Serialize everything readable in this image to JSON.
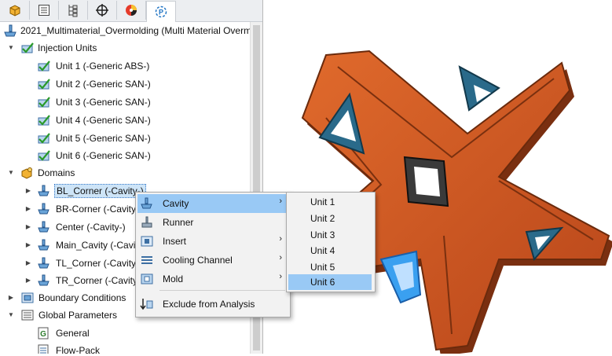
{
  "tabs": [
    {
      "name": "feature-manager",
      "icon": "part-icon"
    },
    {
      "name": "property-manager",
      "icon": "list-icon"
    },
    {
      "name": "configuration-manager",
      "icon": "config-icon"
    },
    {
      "name": "dimxpert-manager",
      "icon": "crosshair-icon"
    },
    {
      "name": "display-manager",
      "icon": "appearance-icon"
    },
    {
      "name": "plastics-manager",
      "icon": "plastics-icon",
      "active": true
    }
  ],
  "tree": {
    "root": "2021_Multimaterial_Overmolding (Multi Material Overmolc",
    "injection_units": {
      "label": "Injection Units",
      "units": [
        "Unit 1 (-Generic ABS-)",
        "Unit 2 (-Generic SAN-)",
        "Unit 3 (-Generic SAN-)",
        "Unit 4 (-Generic SAN-)",
        "Unit 5 (-Generic SAN-)",
        "Unit 6 (-Generic SAN-)"
      ]
    },
    "domains": {
      "label": "Domains",
      "items": [
        "BL_Corner (-Cavity-)",
        "BR-Corner (-Cavity-)",
        "Center (-Cavity-)",
        "Main_Cavity (-Cavity-)",
        "TL_Corner (-Cavity-)",
        "TR_Corner (-Cavity-)"
      ]
    },
    "boundary_conditions": "Boundary Conditions",
    "global_parameters": {
      "label": "Global Parameters",
      "items": [
        "General",
        "Flow-Pack"
      ]
    }
  },
  "context_menu": {
    "items": [
      {
        "label": "Cavity",
        "submenu": true,
        "highlighted": true,
        "icon": "cavity-icon"
      },
      {
        "label": "Runner",
        "submenu": false,
        "icon": "runner-icon"
      },
      {
        "label": "Insert",
        "submenu": true,
        "icon": "insert-icon"
      },
      {
        "label": "Cooling Channel",
        "submenu": true,
        "icon": "cooling-channel-icon"
      },
      {
        "label": "Mold",
        "submenu": true,
        "icon": "mold-icon"
      },
      {
        "label": "Exclude from Analysis",
        "submenu": false,
        "icon": "exclude-icon"
      }
    ]
  },
  "submenu": {
    "items": [
      "Unit 1",
      "Unit 2",
      "Unit 3",
      "Unit 4",
      "Unit 5",
      "Unit 6"
    ],
    "highlighted": "Unit 6"
  },
  "colors": {
    "part": "#d2561e",
    "cavity": "#2a6a8a",
    "center_cavity": "#3a3a3a",
    "selected_cavity": "#3aa0f0",
    "menu_highlight": "#99c9f5"
  }
}
